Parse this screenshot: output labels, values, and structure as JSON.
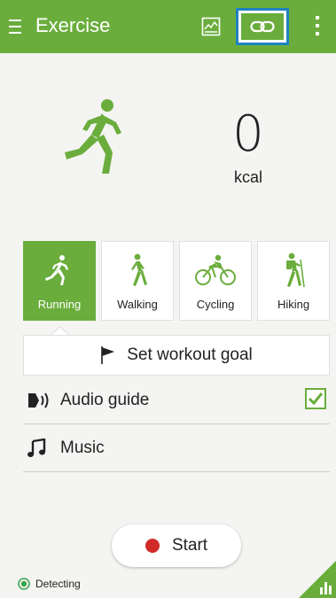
{
  "header": {
    "title": "Exercise",
    "menu_icon": "hamburger-icon",
    "chart_icon": "chart-icon",
    "link_icon": "link-icon",
    "overflow_icon": "overflow-menu-icon",
    "accent": "#6aad3c",
    "highlight": "#1f83c2"
  },
  "calories": {
    "value": "0",
    "unit": "kcal"
  },
  "activities": [
    {
      "label": "Running",
      "icon": "running-icon",
      "selected": true
    },
    {
      "label": "Walking",
      "icon": "walking-icon",
      "selected": false
    },
    {
      "label": "Cycling",
      "icon": "cycling-icon",
      "selected": false
    },
    {
      "label": "Hiking",
      "icon": "hiking-icon",
      "selected": false
    }
  ],
  "goal": {
    "label": "Set workout goal",
    "icon": "flag-icon"
  },
  "audio_guide": {
    "label": "Audio guide",
    "icon": "speaker-icon",
    "checked": true
  },
  "music": {
    "label": "Music",
    "icon": "music-note-icon"
  },
  "start_button": {
    "label": "Start",
    "icon": "record-dot-icon",
    "dot_color": "#d12a2a"
  },
  "status": {
    "label": "Detecting",
    "icon": "gps-icon"
  },
  "corner_icon": "bar-chart-icon"
}
